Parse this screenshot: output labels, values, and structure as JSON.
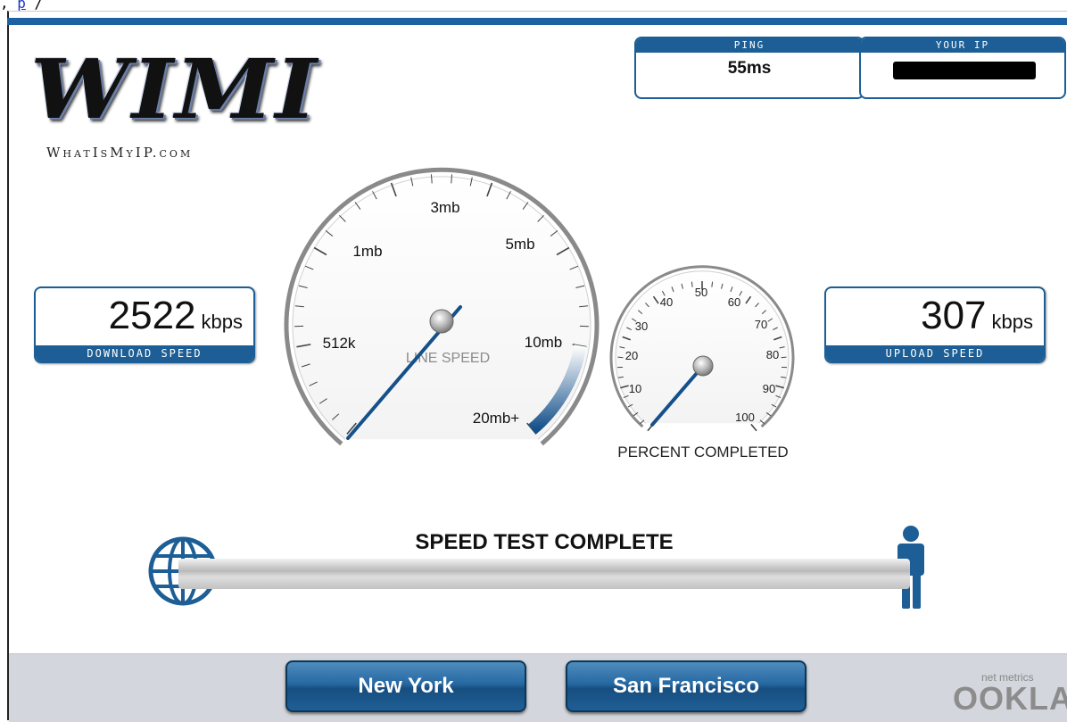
{
  "header_fragment": {
    "prefix": ", ",
    "link": "p",
    "suffix": "                /"
  },
  "logo": {
    "title": "WIMI",
    "subtitle": "WhatIsMyIP.com"
  },
  "ping": {
    "label": "PING",
    "value": "55ms"
  },
  "your_ip": {
    "label": "YOUR IP",
    "value": ""
  },
  "download": {
    "value": "2522",
    "unit": "kbps",
    "label": "DOWNLOAD SPEED"
  },
  "upload": {
    "value": "307",
    "unit": "kbps",
    "label": "UPLOAD SPEED"
  },
  "line_speed_gauge": {
    "label": "LINE SPEED",
    "ticks": [
      "512k",
      "1mb",
      "3mb",
      "5mb",
      "10mb",
      "20mb+"
    ]
  },
  "percent_gauge": {
    "label": "PERCENT COMPLETED",
    "ticks": [
      "10",
      "20",
      "30",
      "40",
      "50",
      "60",
      "70",
      "80",
      "90",
      "100"
    ],
    "value_percent": 0
  },
  "status": "SPEED TEST COMPLETE",
  "servers": [
    "New York",
    "San Francisco"
  ],
  "branding": {
    "small": "net metrics",
    "name": "OOKLA"
  },
  "colors": {
    "accent": "#1c5e95",
    "bar": "#1c62a2",
    "needle": "#14508a"
  }
}
